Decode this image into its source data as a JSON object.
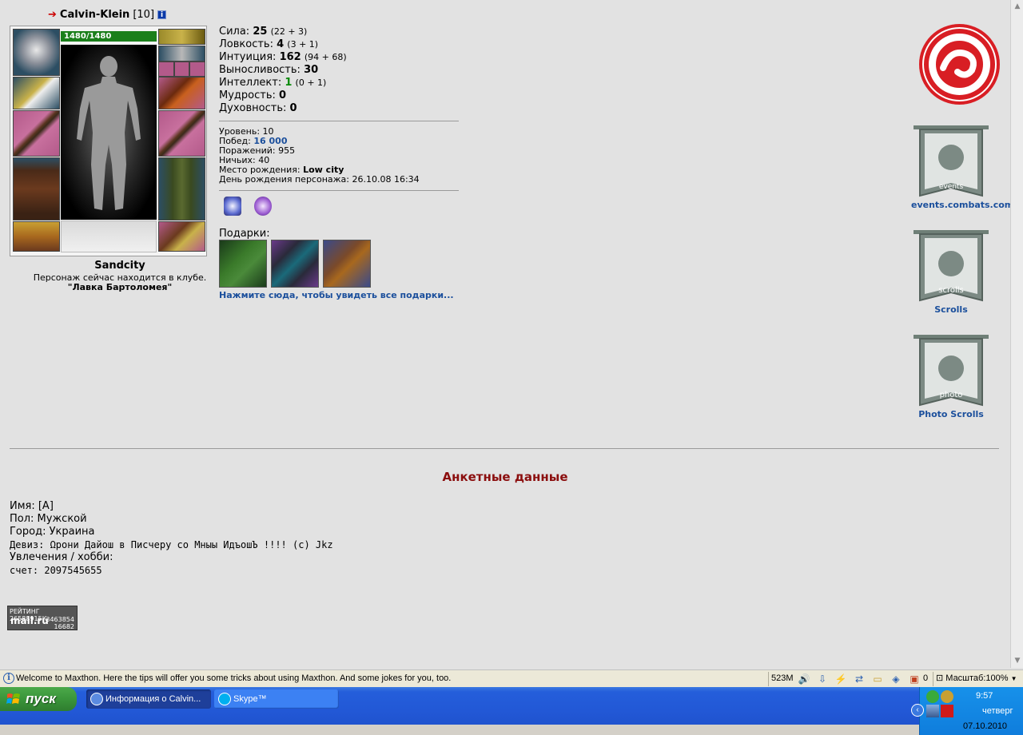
{
  "character": {
    "name": "Calvin-Klein",
    "level": "[10]",
    "hp": "1480/1480",
    "city": "Sandcity",
    "club_text": "Персонаж сейчас находится в клубе.",
    "club_name": "\"Лавка Бартоломея\""
  },
  "stats": [
    {
      "label": "Сила:",
      "value": "25",
      "extra": "(22 + 3)"
    },
    {
      "label": "Ловкость:",
      "value": "4",
      "extra": "(3 + 1)"
    },
    {
      "label": "Интуиция:",
      "value": "162",
      "extra": "(94 + 68)"
    },
    {
      "label": "Выносливость:",
      "value": "30",
      "extra": ""
    },
    {
      "label": "Интеллект:",
      "value": "1",
      "extra": "(0 + 1)"
    },
    {
      "label": "Мудрость:",
      "value": "0",
      "extra": ""
    },
    {
      "label": "Духовность:",
      "value": "0",
      "extra": ""
    }
  ],
  "records": {
    "level": {
      "label": "Уровень:",
      "value": "10"
    },
    "wins": {
      "label": "Побед:",
      "value": "16 000"
    },
    "losses": {
      "label": "Поражений:",
      "value": "955"
    },
    "draws": {
      "label": "Ничьих:",
      "value": "40"
    },
    "birthplace": {
      "label": "Место рождения:",
      "value": "Low city"
    },
    "birthday": {
      "label": "День рождения персонажа:",
      "value": "26.10.08 16:34"
    }
  },
  "gifts": {
    "label": "Подарки:",
    "link": "Нажмите сюда, чтобы увидеть все подарки..."
  },
  "sidebar": {
    "events_label": "events.combats.com",
    "events_flag_text": "events",
    "scrolls_label": "Scrolls",
    "scrolls_flag_text": "scrolls",
    "photo_label": "Photo Scrolls",
    "photo_flag_text": "photo"
  },
  "profile": {
    "title": "Анкетные данные",
    "name": "Имя: [A]",
    "gender": "Пол: Мужской",
    "city": "Город: Украина",
    "motto": "Девиз: Ωрони Дайош в Писчеру со Мныы ИдъошЪ !!!! (c) Jkz",
    "hobbies": "Увлечения / хобби:",
    "account": "счет: 2097545655"
  },
  "counter": {
    "line1": "РЕЙТИНГ 26588915К",
    "brand": "mail.ru",
    "line2": "3463854",
    "line3": "16682"
  },
  "statusbar": {
    "tip": "Welcome to Maxthon. Here the tips will offer you some tricks about using Maxthon. And some jokes for you, too.",
    "memory": "523M",
    "popup_count": "0",
    "zoom": "Масштаб:100%"
  },
  "taskbar": {
    "start": "пуск",
    "task1": "Информация о Calvin...",
    "task2": "Skype™",
    "time": "9:57",
    "day": "четверг",
    "date": "07.10.2010"
  },
  "colors": {
    "link": "#1b4f9c",
    "profile_title": "#8b0e0e",
    "hp_bar": "#1b7f1b",
    "logo_red": "#d81e24"
  }
}
